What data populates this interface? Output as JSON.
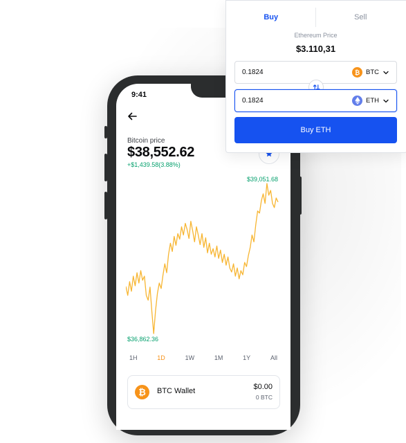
{
  "status_bar": {
    "time": "9:41"
  },
  "coin": {
    "price_label": "Bitcoin price",
    "price": "$38,552.62",
    "change": "+$1,439.58(3.88%)",
    "high_label": "$39,051.68",
    "low_label": "$36,862.36"
  },
  "ranges": [
    {
      "label": "1H",
      "active": false
    },
    {
      "label": "1D",
      "active": true
    },
    {
      "label": "1W",
      "active": false
    },
    {
      "label": "1M",
      "active": false
    },
    {
      "label": "1Y",
      "active": false
    },
    {
      "label": "All",
      "active": false
    }
  ],
  "wallet": {
    "name": "BTC Wallet",
    "fiat_balance": "$0.00",
    "crypto_balance": "0 BTC",
    "icon": "bitcoin-icon"
  },
  "trade": {
    "tabs": [
      "Buy",
      "Sell"
    ],
    "active_tab": "Buy",
    "eth_price_label": "Ethereum Price",
    "eth_price": "$3.110,31",
    "from_amount": "0.1824",
    "from_currency": "BTC",
    "to_amount": "0.1824",
    "to_currency": "ETH",
    "buy_button": "Buy ETH"
  },
  "colors": {
    "brand_blue": "#1652f0",
    "bitcoin_orange": "#f7931a",
    "ethereum_purple": "#627eea",
    "positive_green": "#05a06d",
    "chart_line": "#f7b531"
  },
  "chart_data": {
    "type": "line",
    "x_unit": "time (1D range)",
    "y_unit": "USD",
    "ylim": [
      36862.36,
      39051.68
    ],
    "values": [
      37550,
      37420,
      37620,
      37480,
      37700,
      37560,
      37750,
      37600,
      37780,
      37640,
      37700,
      37420,
      37350,
      37540,
      37180,
      36862.36,
      37200,
      37450,
      37600,
      37520,
      37720,
      37880,
      37750,
      38020,
      38180,
      38060,
      38280,
      38150,
      38320,
      38240,
      38420,
      38300,
      38470,
      38380,
      38250,
      38500,
      38360,
      38200,
      38420,
      38300,
      38160,
      38320,
      38120,
      38260,
      38040,
      38180,
      38020,
      38100,
      37980,
      38140,
      37960,
      38080,
      37900,
      38020,
      37860,
      37980,
      37820,
      37760,
      37880,
      37700,
      37820,
      37660,
      37780,
      37720,
      37900,
      37840,
      38000,
      38120,
      38300,
      38200,
      38450,
      38650,
      38620,
      38800,
      38900,
      38760,
      39051.68,
      38880,
      38950,
      38760,
      38700,
      38840,
      38780
    ]
  }
}
